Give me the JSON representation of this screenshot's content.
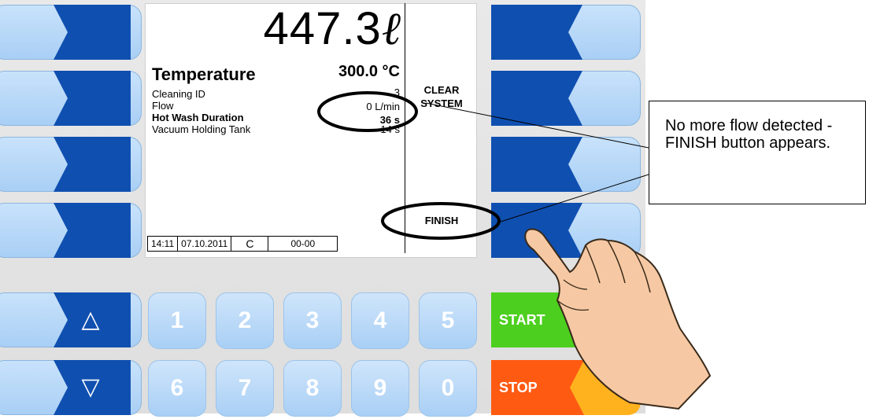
{
  "screen": {
    "volume": "447.3",
    "volume_unit": "ℓ",
    "temperature_label": "Temperature",
    "temperature_value": "300.0 °C",
    "rows": [
      {
        "label": "Cleaning ID",
        "value": "3"
      },
      {
        "label": "Flow",
        "value": "0 L/min"
      },
      {
        "label": "Hot Wash Duration",
        "value": "36 s"
      },
      {
        "label": "Vacuum Holding Tank",
        "value": "14 s"
      }
    ],
    "commands": {
      "clear_system_line1": "CLEAR",
      "clear_system_line2": "SYSTEM",
      "finish": "FINISH"
    },
    "status": {
      "time": "14:11",
      "date": "07.10.2011",
      "mode": "C",
      "code": "00-00"
    }
  },
  "keypad": {
    "up_symbol": "△",
    "down_symbol": "▽",
    "row1": [
      "1",
      "2",
      "3",
      "4",
      "5"
    ],
    "row2": [
      "6",
      "7",
      "8",
      "9",
      "0"
    ],
    "start": "START",
    "stop": "STOP"
  },
  "callout": {
    "text": "No more flow detected - FINISH button appears."
  },
  "colors": {
    "button_dark": "#0f4fb0",
    "button_light": "#b8d8f8",
    "start_green": "#4ccf1e",
    "stop_orange": "#ff5a12",
    "stop_light": "#ffb21e"
  }
}
